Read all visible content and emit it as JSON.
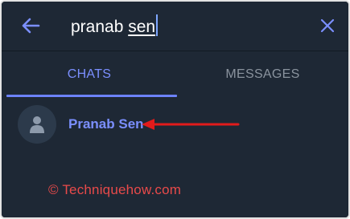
{
  "search": {
    "query_plain": "pranab ",
    "query_underlined": "sen"
  },
  "icons": {
    "back": "arrow-left-icon",
    "close": "close-icon",
    "avatar": "person-icon"
  },
  "tabs": [
    {
      "label": "CHATS",
      "active": true
    },
    {
      "label": "MESSAGES",
      "active": false
    }
  ],
  "results": [
    {
      "name": "Pranab Sen"
    }
  ],
  "watermark": "© Techniquehow.com",
  "colors": {
    "background": "#1e2835",
    "accent": "#7b8fff",
    "annotation": "#e21b1b"
  }
}
